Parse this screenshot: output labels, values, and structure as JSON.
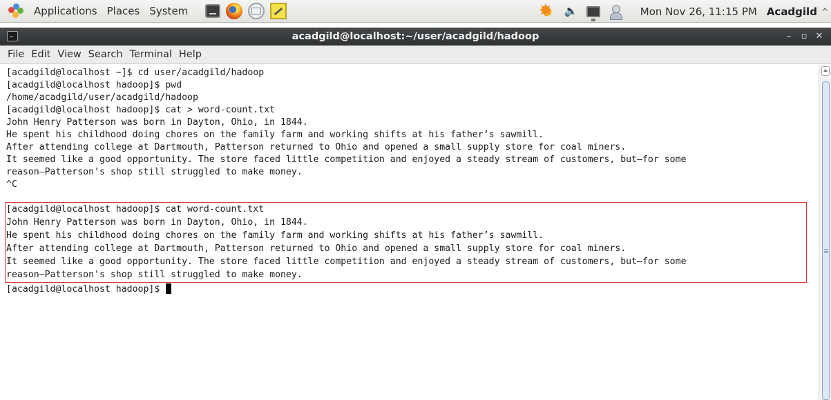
{
  "panel": {
    "menus": [
      "Applications",
      "Places",
      "System"
    ],
    "clock": "Mon Nov 26, 11:15 PM",
    "username": "Acadgild",
    "launchers": [
      "terminal-icon",
      "firefox-icon",
      "mail-icon",
      "notes-icon"
    ],
    "tray_icons": [
      "update-icon",
      "volume-icon",
      "network-icon",
      "user-icon"
    ]
  },
  "window": {
    "title": "acadgild@localhost:~/user/acadgild/hadoop",
    "controls": [
      "minimize",
      "maximize",
      "close"
    ]
  },
  "menubar": [
    "File",
    "Edit",
    "View",
    "Search",
    "Terminal",
    "Help"
  ],
  "terminal": {
    "lines": [
      "[acadgild@localhost ~]$ cd user/acadgild/hadoop",
      "[acadgild@localhost hadoop]$ pwd",
      "/home/acadgild/user/acadgild/hadoop",
      "[acadgild@localhost hadoop]$ cat > word-count.txt",
      "John Henry Patterson was born in Dayton, Ohio, in 1844.",
      "He spent his childhood doing chores on the family farm and working shifts at his father’s sawmill.",
      "After attending college at Dartmouth, Patterson returned to Ohio and opened a small supply store for coal miners.",
      "It seemed like a good opportunity. The store faced little competition and enjoyed a steady stream of customers, but—for some",
      "reason—Patterson's shop still struggled to make money.",
      "^C",
      "[acadgild@localhost hadoop]$ cat word-count.txt",
      "John Henry Patterson was born in Dayton, Ohio, in 1844.",
      "He spent his childhood doing chores on the family farm and working shifts at his father’s sawmill.",
      "After attending college at Dartmouth, Patterson returned to Ohio and opened a small supply store for coal miners.",
      "It seemed like a good opportunity. The store faced little competition and enjoyed a steady stream of customers, but—for some",
      "reason—Patterson's shop still struggled to make money.",
      "[acadgild@localhost hadoop]$ "
    ],
    "highlight_color": "#d53a3a"
  }
}
